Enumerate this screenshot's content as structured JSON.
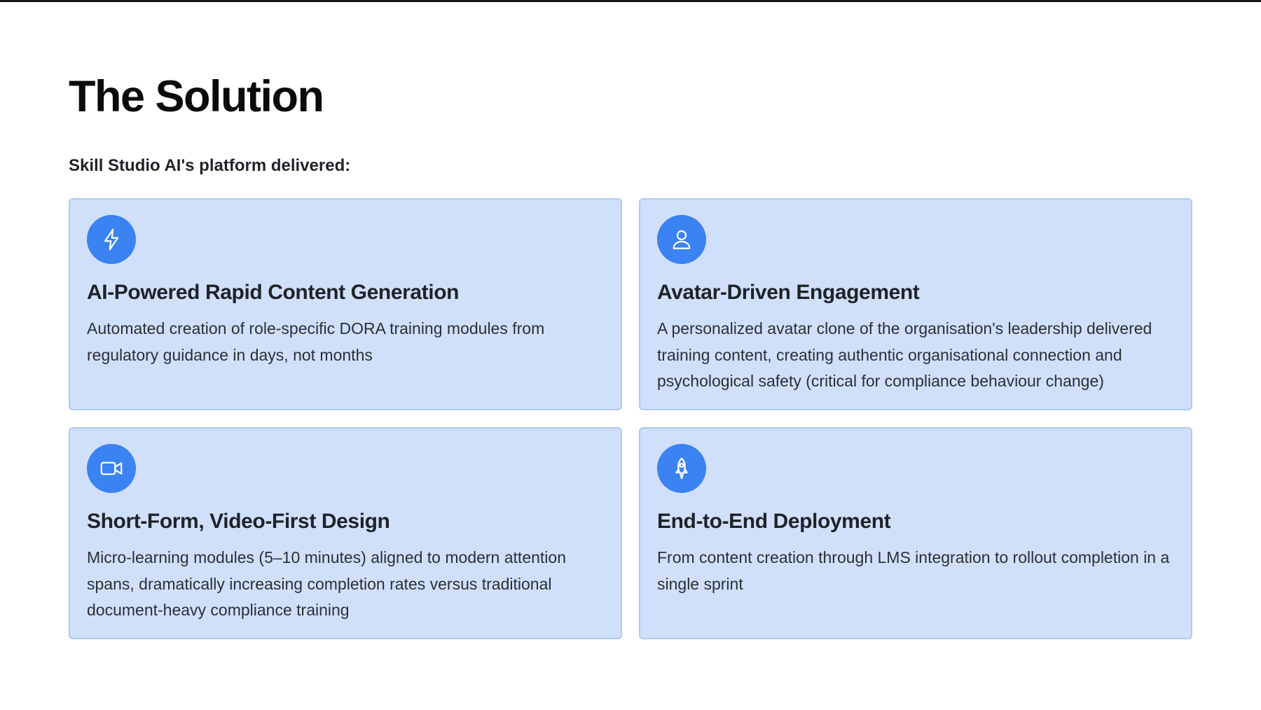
{
  "slide": {
    "title": "The Solution",
    "subtitle": "Skill Studio AI's platform delivered:"
  },
  "cards": [
    {
      "icon": "lightning-icon",
      "title": "AI-Powered Rapid Content Generation",
      "description": "Automated creation of role-specific DORA training modules from regulatory guidance in days, not months"
    },
    {
      "icon": "user-icon",
      "title": "Avatar-Driven Engagement",
      "description": "A personalized avatar clone of the organisation's leadership delivered training content, creating authentic organisational connection and psychological safety (critical for compliance behaviour change)"
    },
    {
      "icon": "video-camera-icon",
      "title": "Short-Form, Video-First Design",
      "description": "Micro-learning modules (5–10 minutes) aligned to modern attention spans, dramatically increasing completion rates versus traditional document-heavy compliance training"
    },
    {
      "icon": "rocket-icon",
      "title": "End-to-End Deployment",
      "description": "From content creation through LMS integration to rollout completion in a single sprint"
    }
  ],
  "colors": {
    "card_background": "#d0e0fb",
    "card_border": "#b3c9ee",
    "icon_circle": "#3b82f2",
    "title_text": "#0b0b0b",
    "body_text": "#2b2f36"
  }
}
